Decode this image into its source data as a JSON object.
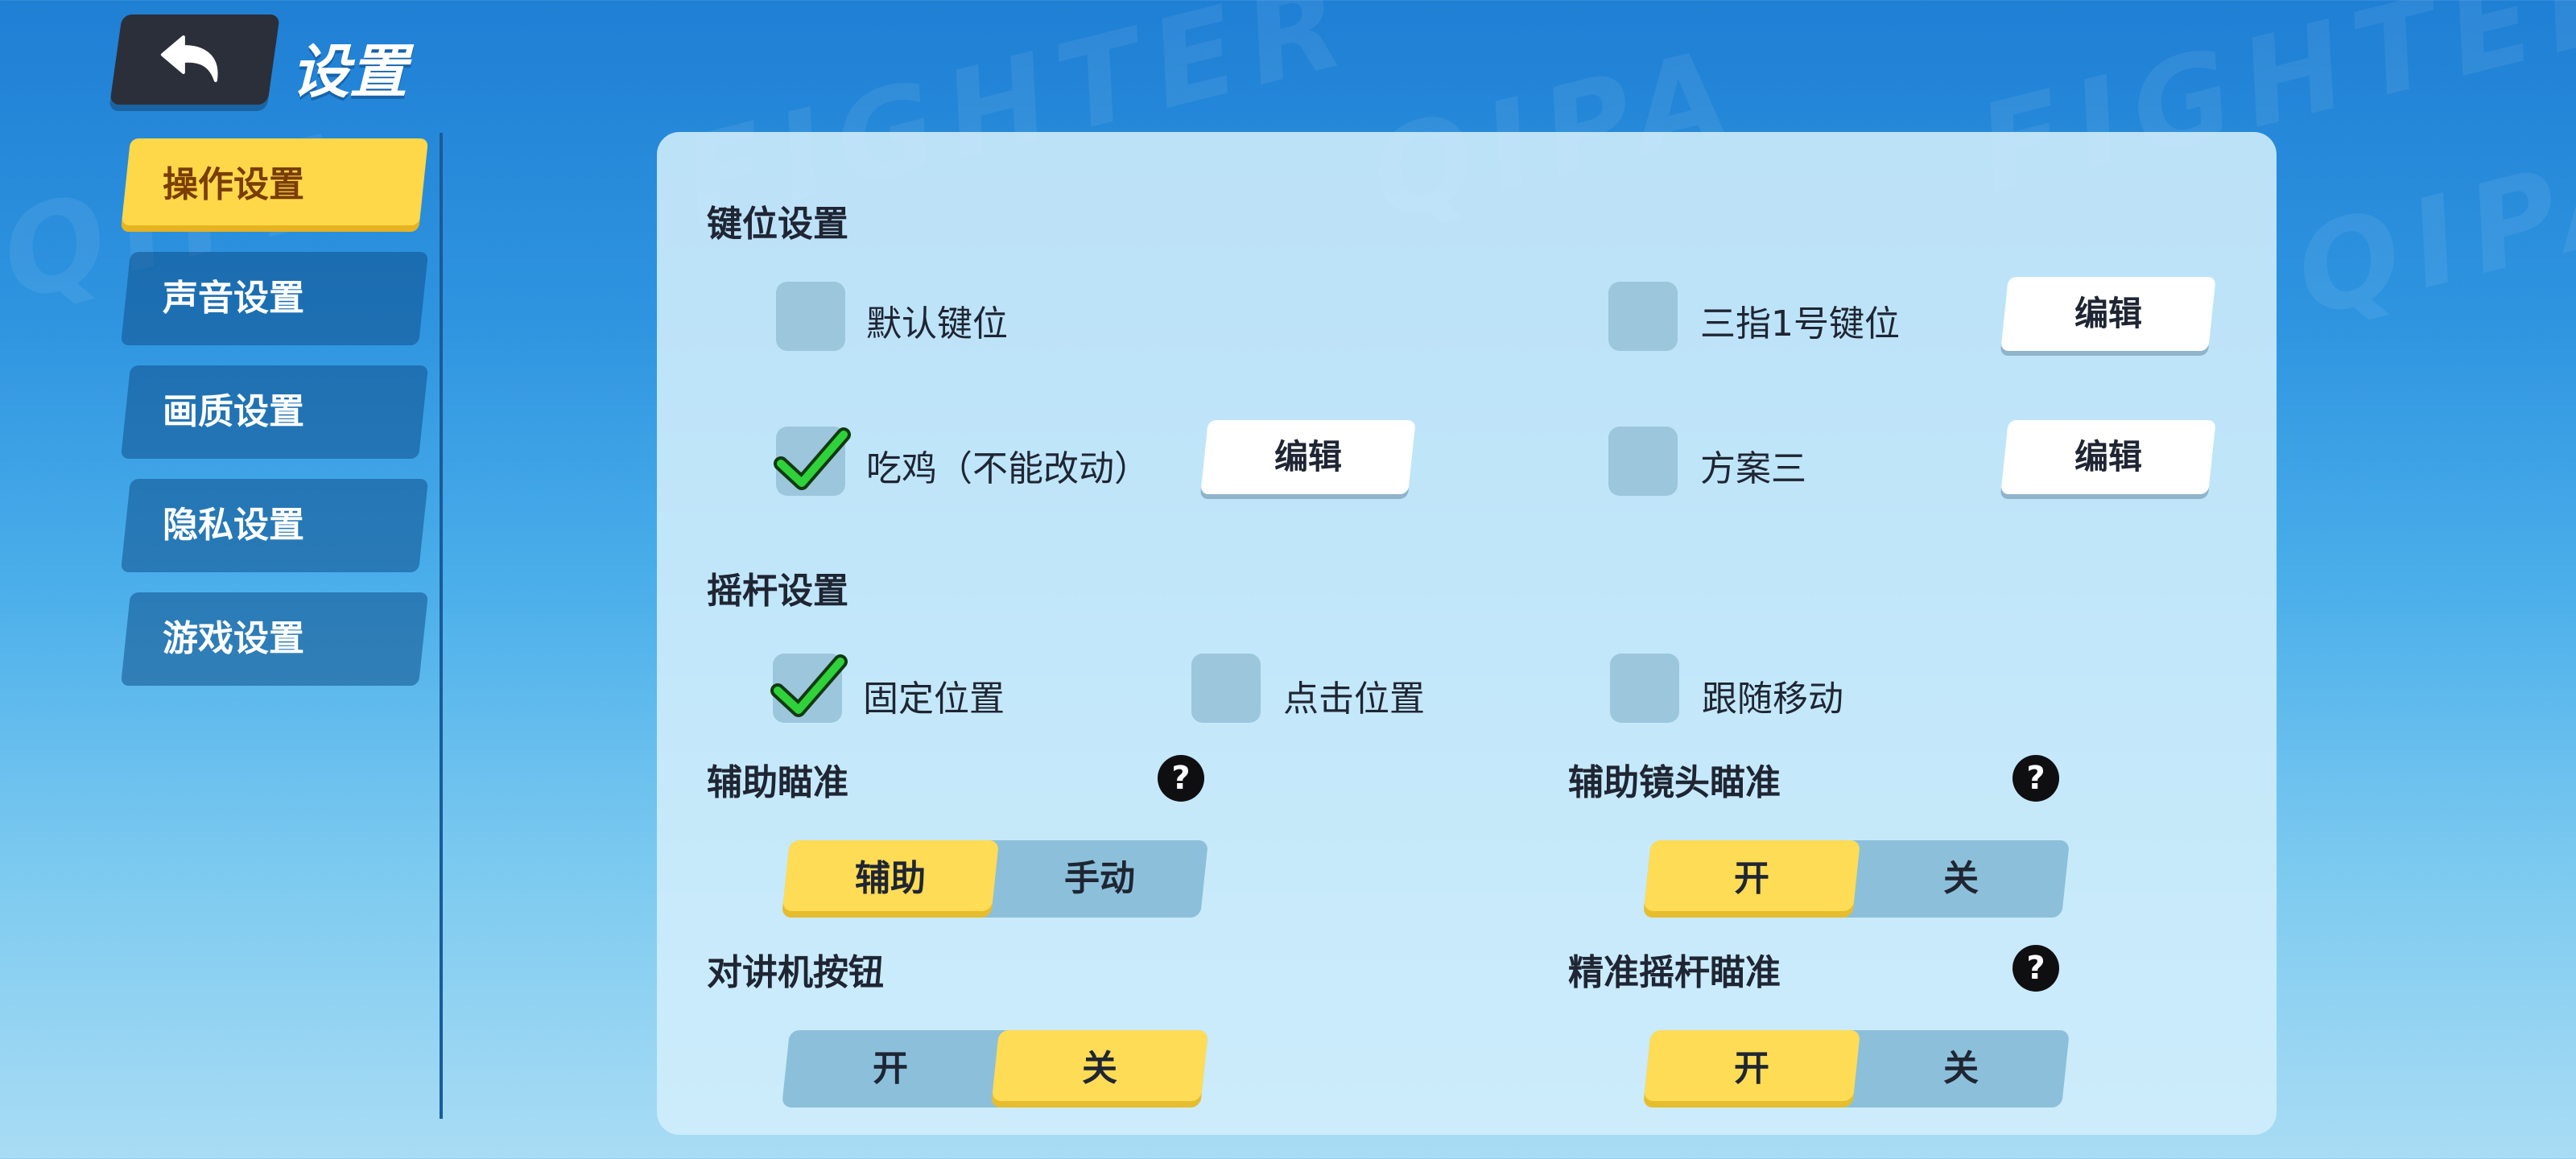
{
  "header": {
    "title": "设置"
  },
  "sidebar": {
    "items": [
      {
        "label": "操作设置",
        "active": true
      },
      {
        "label": "声音设置",
        "active": false
      },
      {
        "label": "画质设置",
        "active": false
      },
      {
        "label": "隐私设置",
        "active": false
      },
      {
        "label": "游戏设置",
        "active": false
      }
    ]
  },
  "keymap": {
    "title": "键位设置",
    "options": [
      {
        "label": "默认键位",
        "checked": false,
        "editable": false
      },
      {
        "label": "三指1号键位",
        "checked": false,
        "editable": true,
        "edit_label": "编辑"
      },
      {
        "label": "吃鸡（不能改动）",
        "checked": true,
        "editable": true,
        "edit_label": "编辑"
      },
      {
        "label": "方案三",
        "checked": false,
        "editable": true,
        "edit_label": "编辑"
      }
    ]
  },
  "joystick": {
    "title": "摇杆设置",
    "options": [
      {
        "label": "固定位置",
        "checked": true
      },
      {
        "label": "点击位置",
        "checked": false
      },
      {
        "label": "跟随移动",
        "checked": false
      }
    ]
  },
  "aim_assist": {
    "title": "辅助瞄准",
    "help": "?",
    "options": [
      "辅助",
      "手动"
    ],
    "selected": 0
  },
  "camera_aim": {
    "title": "辅助镜头瞄准",
    "help": "?",
    "options": [
      "开",
      "关"
    ],
    "selected": 0
  },
  "walkie_talkie": {
    "title": "对讲机按钮",
    "options": [
      "开",
      "关"
    ],
    "selected": 1
  },
  "precise_joystick": {
    "title": "精准摇杆瞄准",
    "help": "?",
    "options": [
      "开",
      "关"
    ],
    "selected": 0
  },
  "background_text": {
    "words": [
      "FIGHTER",
      "QIPA"
    ]
  },
  "colors": {
    "accent": "#ffd84a",
    "panel": "#d2eefc",
    "check": "#2fd23a"
  }
}
